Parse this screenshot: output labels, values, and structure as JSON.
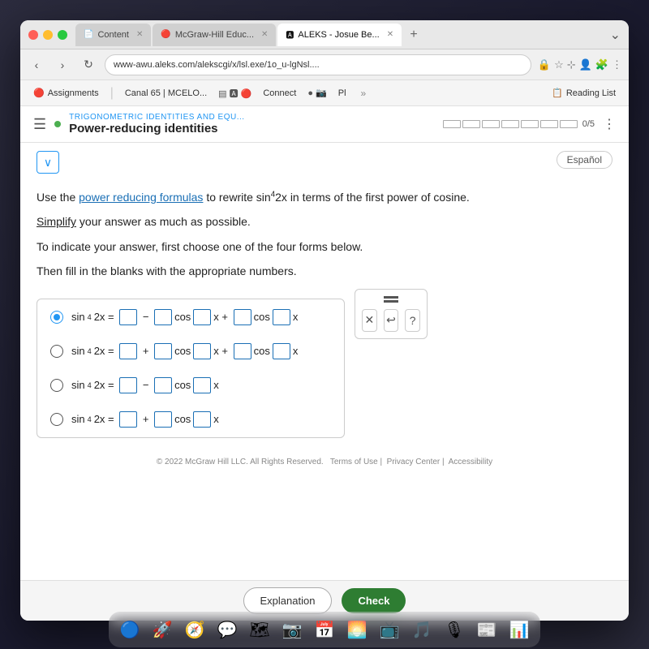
{
  "desktop": {
    "bg_color": "#2c2c3e"
  },
  "browser": {
    "tabs": [
      {
        "id": "content",
        "label": "Content",
        "icon": "📄",
        "active": false
      },
      {
        "id": "mcgrawhill",
        "label": "McGraw-Hill Educ...",
        "icon": "🔴",
        "active": false
      },
      {
        "id": "aleks",
        "label": "ALEKS - Josue Be...",
        "icon": "🅰",
        "active": true
      }
    ],
    "address": "www-awu.aleks.com/alekscgi/x/lsl.exe/1o_u-lgNsl....",
    "bookmarks": [
      {
        "id": "assignments",
        "label": "Assignments",
        "icon": "🔴"
      },
      {
        "id": "canal65",
        "label": "Canal 65 | MCELO...",
        "icon": ""
      },
      {
        "id": "connect",
        "label": "Connect",
        "icon": ""
      },
      {
        "id": "pi",
        "label": "Pl",
        "icon": ""
      }
    ],
    "reading_list_label": "Reading List"
  },
  "aleks": {
    "topic_subtitle": "TRIGONOMETRIC IDENTITIES AND EQU...",
    "topic_title": "Power-reducing identities",
    "progress_total": 5,
    "progress_filled": 0,
    "progress_label": "0/5",
    "espanol_label": "Español",
    "chevron_label": "∨",
    "instructions": [
      "Use the power reducing formulas to rewrite sin⁴2x in terms of the first power of cosine.",
      "Simplify your answer as much as possible.",
      "To indicate your answer, first choose one of the four forms below.",
      "Then fill in the blanks with the appropriate numbers."
    ],
    "choices": [
      {
        "id": "choice1",
        "selected": true,
        "formula": "sin⁴2x = □ - □cos□x + □cos□x"
      },
      {
        "id": "choice2",
        "selected": false,
        "formula": "sin⁴2x = □ + □cos□x + □cos□x"
      },
      {
        "id": "choice3",
        "selected": false,
        "formula": "sin⁴2x = □ - □cos□x"
      },
      {
        "id": "choice4",
        "selected": false,
        "formula": "sin⁴2x = □ + □cos□x"
      }
    ],
    "buttons": {
      "explanation": "Explanation",
      "check": "Check"
    },
    "copyright": "© 2022 McGraw Hill LLC. All Rights Reserved.",
    "terms_label": "Terms of Use",
    "privacy_label": "Privacy Center",
    "accessibility_label": "Accessibility"
  },
  "dock": {
    "items": [
      {
        "id": "finder",
        "emoji": "😊",
        "label": "Finder"
      },
      {
        "id": "launchpad",
        "emoji": "🚀",
        "label": "Launchpad"
      },
      {
        "id": "safari",
        "emoji": "🧭",
        "label": "Safari"
      },
      {
        "id": "messages",
        "emoji": "💬",
        "label": "Messages"
      },
      {
        "id": "maps",
        "emoji": "🗺",
        "label": "Maps"
      },
      {
        "id": "facetime",
        "emoji": "📷",
        "label": "FaceTime"
      },
      {
        "id": "calendar",
        "emoji": "📅",
        "label": "Calendar"
      },
      {
        "id": "photos",
        "emoji": "🖼",
        "label": "Photos"
      },
      {
        "id": "appletv",
        "emoji": "📺",
        "label": "Apple TV"
      },
      {
        "id": "music",
        "emoji": "🎵",
        "label": "Music"
      },
      {
        "id": "podcasts",
        "emoji": "🎙",
        "label": "Podcasts"
      },
      {
        "id": "news",
        "emoji": "📰",
        "label": "News"
      },
      {
        "id": "numbers",
        "emoji": "📊",
        "label": "Numbers"
      }
    ]
  }
}
